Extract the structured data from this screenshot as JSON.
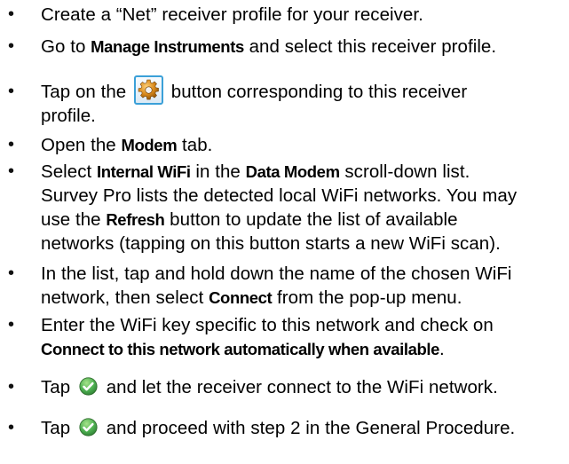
{
  "icons": {
    "bullet": "•",
    "gear": "gear-icon",
    "ok": "check-circle-icon",
    "ok_color": "#4caf50",
    "gear_border_color": "#3ba0d8"
  },
  "steps": {
    "s1": {
      "line1": "Create a “Net” receiver profile for your receiver."
    },
    "s2": {
      "pre": "Go to ",
      "bold": "Manage Instruments",
      "post": " and select this receiver profile."
    },
    "s3": {
      "pre": "Tap on the ",
      "post": " button corresponding to this receiver",
      "line2": "profile."
    },
    "s4": {
      "pre": "Open the ",
      "bold": "Modem",
      "post": " tab."
    },
    "s5": {
      "pre": "Select ",
      "bold1": "Internal WiFi",
      "mid": " in the ",
      "bold2": "Data Modem",
      "post": " scroll-down list.",
      "line2": "Survey Pro lists the detected local WiFi networks. You may",
      "line3_pre": "use the ",
      "line3_bold": "Refresh",
      "line3_post": " button to update the list of available",
      "line4": "networks (tapping on this button starts a new WiFi scan)."
    },
    "s6": {
      "line1": "In the list, tap and hold down the name of the chosen WiFi",
      "line2_pre": "network, then select ",
      "line2_bold": "Connect",
      "line2_post": " from the pop-up menu."
    },
    "s7": {
      "line1": "Enter the WiFi key specific to this network and check on",
      "line2_bold": "Connect to this network automatically when available",
      "line2_post": "."
    },
    "s8": {
      "pre": "Tap ",
      "post": " and let the receiver connect to the WiFi network."
    },
    "s9": {
      "pre": "Tap ",
      "post": " and proceed with step 2 in the General Procedure."
    }
  }
}
